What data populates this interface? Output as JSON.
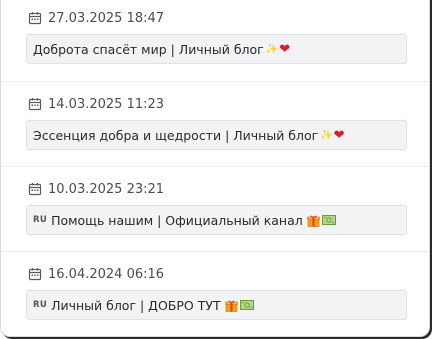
{
  "entries": [
    {
      "date": "27.03.2025 18:47",
      "message": "Доброта спасёт мир | Личный блог",
      "sparkle": "✨",
      "heart": "❤",
      "icons": [
        "sparkle-icon",
        "heart-icon"
      ]
    },
    {
      "date": "14.03.2025 11:23",
      "message": "Эссенция добра и щедрости | Личный блог",
      "sparkle": "✨",
      "heart": "❤",
      "icons": [
        "sparkle-icon",
        "heart-icon"
      ]
    },
    {
      "date": "10.03.2025 23:21",
      "badge": "RU",
      "message": "Помощь нашим | Официальный канал",
      "icons": [
        "ru-flag-icon",
        "gift-icon",
        "money-bill-icon"
      ]
    },
    {
      "date": "16.04.2024 06:16",
      "badge": "RU",
      "message": "Личный блог | ДОБРО ТУТ",
      "icons": [
        "ru-flag-icon",
        "gift-icon",
        "money-bill-icon"
      ]
    }
  ],
  "colors": {
    "box_bg": "#f1f3f5",
    "box_border": "#dfe3e7",
    "date_text": "#4b4b55",
    "heart": "#e0182d",
    "gift": "#f2a01a",
    "bill": "#6a9a3a"
  }
}
